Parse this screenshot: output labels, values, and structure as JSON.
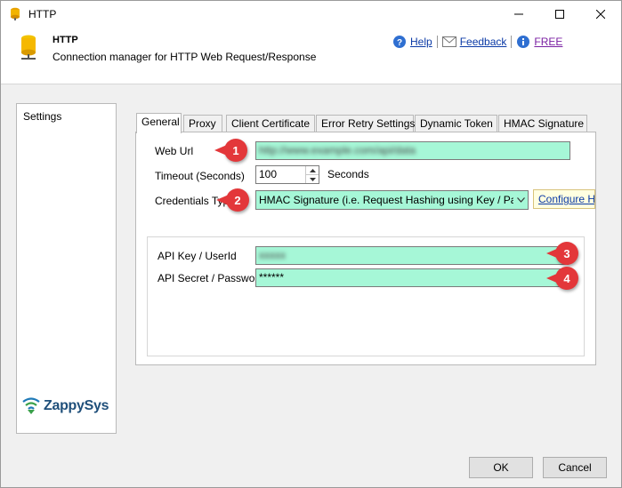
{
  "window": {
    "title": "HTTP"
  },
  "header": {
    "title": "HTTP",
    "description": "Connection manager for HTTP Web Request/Response",
    "links": {
      "help": "Help",
      "feedback": "Feedback",
      "free": "FREE"
    }
  },
  "sidebar": {
    "settings_label": "Settings",
    "logo_brand": "ZappySys"
  },
  "tabs": [
    {
      "label": "General",
      "active": true
    },
    {
      "label": "Proxy",
      "active": false
    },
    {
      "label": "Client Certificate",
      "active": false
    },
    {
      "label": "Error Retry Settings",
      "active": false
    },
    {
      "label": "Dynamic Token",
      "active": false
    },
    {
      "label": "HMAC Signature",
      "active": false
    }
  ],
  "general": {
    "web_url_label": "Web Url",
    "web_url_value": "http://www.example.com/api/data",
    "timeout_label": "Timeout (Seconds)",
    "timeout_value": "100",
    "timeout_unit": "Seconds",
    "credentials_label": "Credentials Typ",
    "credentials_value": "HMAC Signature (i.e. Request Hashing using Key / Pa",
    "configure_label": "Configure H",
    "api_key_label": "API Key / UserId",
    "api_key_value": "xxxxx",
    "api_secret_label": "API Secret / Password",
    "api_secret_value": "******"
  },
  "callouts": [
    "1",
    "2",
    "3",
    "4"
  ],
  "footer": {
    "ok_label": "OK",
    "cancel_label": "Cancel"
  },
  "colors": {
    "field_fill": "#a6f7d7",
    "callout_red": "#e3373a",
    "link_blue": "#0b3aa6"
  }
}
